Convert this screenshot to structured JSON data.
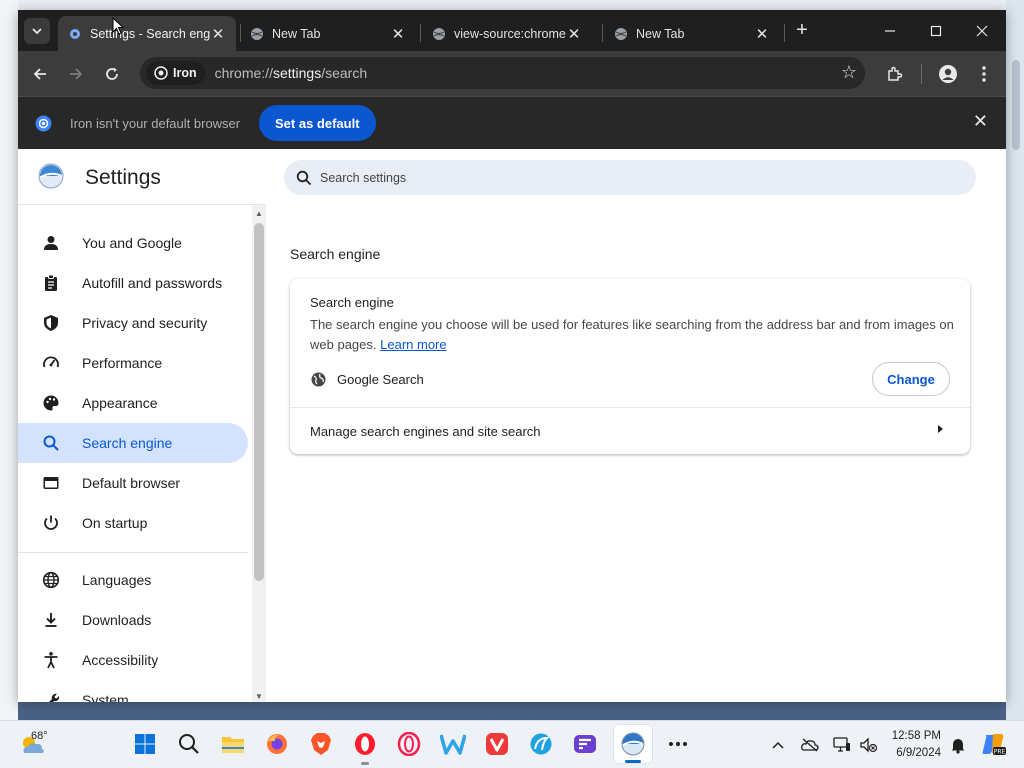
{
  "browser": {
    "tabs": [
      {
        "title": "Settings - Search engine",
        "active": true
      },
      {
        "title": "New Tab",
        "active": false
      },
      {
        "title": "view-source:chrome://",
        "active": false
      },
      {
        "title": "New Tab",
        "active": false
      }
    ],
    "chip_label": "Iron",
    "url_prefix": "chrome://",
    "url_highlight": "settings",
    "url_suffix": "/search"
  },
  "infobar": {
    "message": "Iron isn't your default browser",
    "button_label": "Set as default"
  },
  "settings": {
    "title": "Settings",
    "search_placeholder": "Search settings",
    "nav": [
      {
        "label": "You and Google",
        "icon": "person-icon"
      },
      {
        "label": "Autofill and passwords",
        "icon": "clipboard-icon"
      },
      {
        "label": "Privacy and security",
        "icon": "shield-icon"
      },
      {
        "label": "Performance",
        "icon": "speedometer-icon"
      },
      {
        "label": "Appearance",
        "icon": "palette-icon"
      },
      {
        "label": "Search engine",
        "icon": "search-icon",
        "active": true
      },
      {
        "label": "Default browser",
        "icon": "browser-window-icon"
      },
      {
        "label": "On startup",
        "icon": "power-icon"
      },
      {
        "label": "Languages",
        "icon": "globe-icon"
      },
      {
        "label": "Downloads",
        "icon": "download-icon"
      },
      {
        "label": "Accessibility",
        "icon": "accessibility-icon"
      },
      {
        "label": "System",
        "icon": "wrench-icon"
      }
    ],
    "section_title": "Search engine",
    "card": {
      "heading": "Search engine",
      "description": "The search engine you choose will be used for features like searching from the address bar and from images on web pages.",
      "learn_more": "Learn more",
      "engine_name": "Google Search",
      "change_label": "Change",
      "manage_label": "Manage search engines and site search"
    }
  },
  "taskbar": {
    "temperature": "68°",
    "time": "12:58 PM",
    "date": "6/9/2024",
    "apps": [
      "windows-start-icon",
      "search-icon",
      "file-explorer-icon",
      "firefox-icon",
      "brave-icon",
      "opera-icon",
      "opera-gx-icon",
      "waterfox-icon",
      "vivaldi-icon",
      "edge-dev-icon",
      "floorp-icon",
      "iron-icon",
      "more-icon"
    ]
  },
  "colors": {
    "accent": "#0b57d0",
    "nav_active_bg": "#d3e3fd",
    "tab_bar": "#1f1f1f",
    "toolbar": "#3c3c3c"
  }
}
